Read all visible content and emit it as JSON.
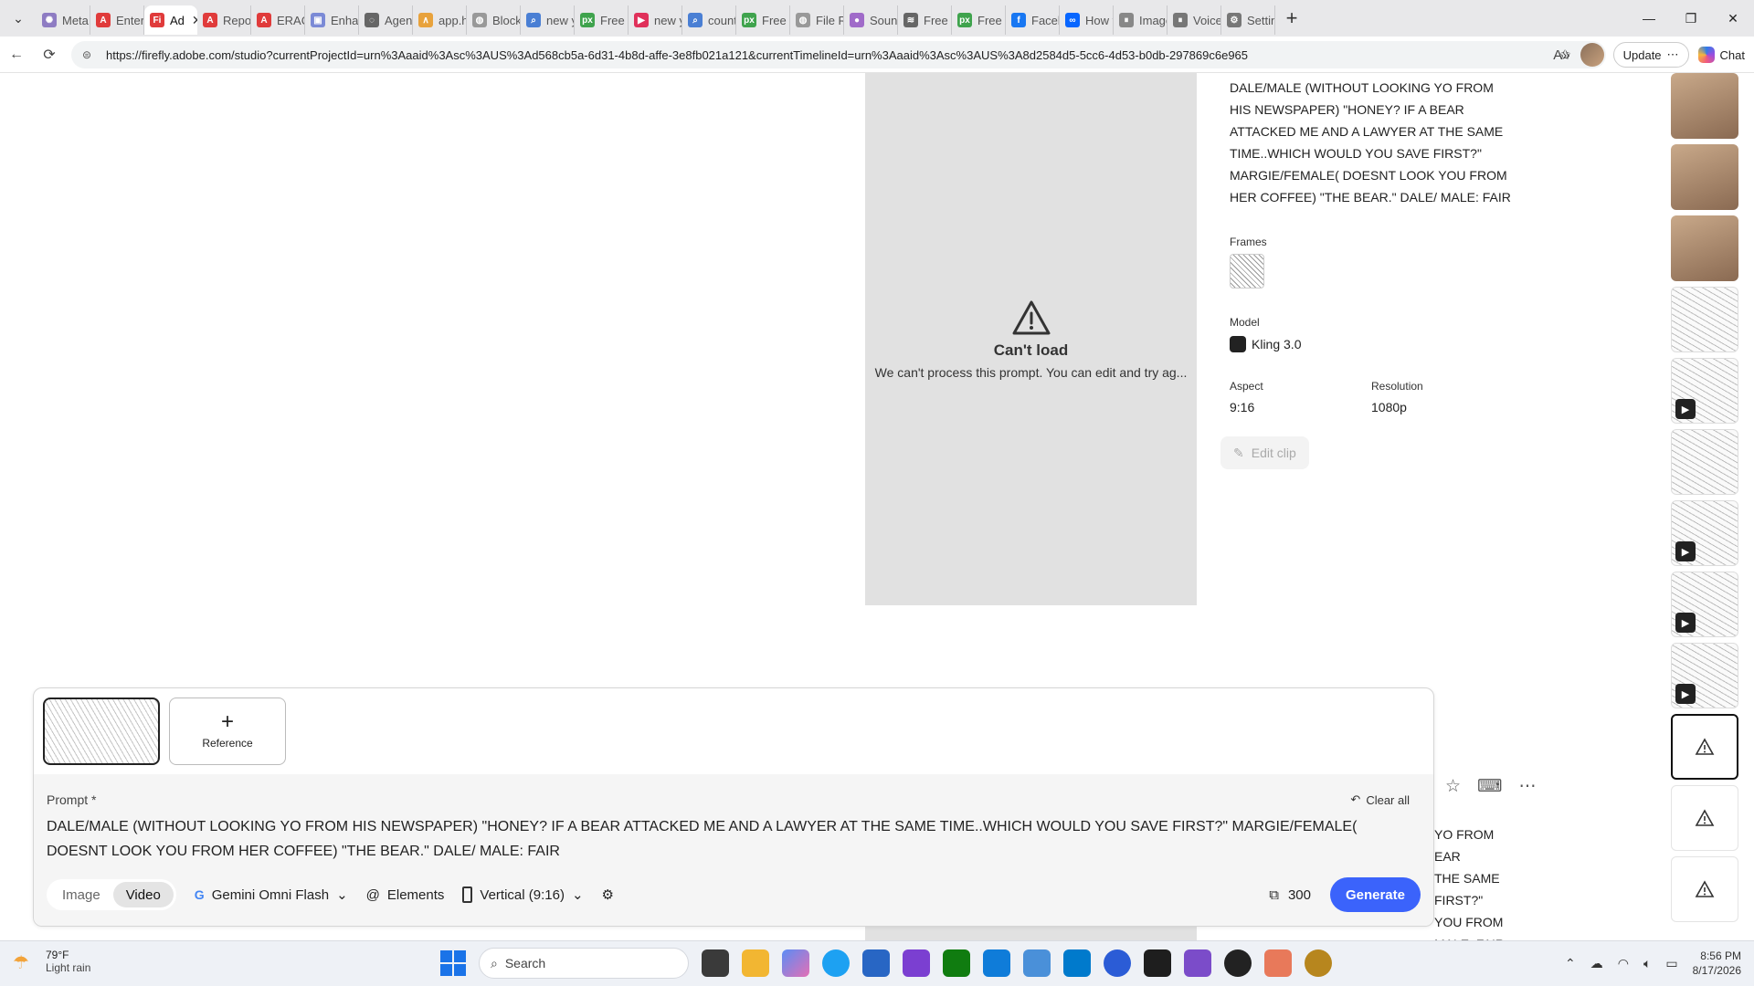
{
  "browser": {
    "tabs": [
      {
        "label": "Meta AI",
        "color": "#8e7cc3",
        "glyph": "✺"
      },
      {
        "label": "Enter y",
        "color": "#e03b3b",
        "glyph": "A"
      },
      {
        "label": "Ad",
        "color": "#e03b3b",
        "glyph": "Fi",
        "active": true
      },
      {
        "label": "Report",
        "color": "#e03b3b",
        "glyph": "A"
      },
      {
        "label": "ERACTI",
        "color": "#e03b3b",
        "glyph": "A"
      },
      {
        "label": "Enhanc",
        "color": "#7b8ad6",
        "glyph": "▣"
      },
      {
        "label": "Agent",
        "color": "#666666",
        "glyph": "◌"
      },
      {
        "label": "app.hy",
        "color": "#e8a23c",
        "glyph": "∧"
      },
      {
        "label": "Block F",
        "color": "#999999",
        "glyph": "◍"
      },
      {
        "label": "new yo",
        "color": "#4a7fd4",
        "glyph": "⌕"
      },
      {
        "label": "Free N",
        "color": "#3fa34d",
        "glyph": "px"
      },
      {
        "label": "new yo",
        "color": "#e0305a",
        "glyph": "▶"
      },
      {
        "label": "countr",
        "color": "#4a7fd4",
        "glyph": "⌕"
      },
      {
        "label": "Free M",
        "color": "#3fa34d",
        "glyph": "px"
      },
      {
        "label": "File Re",
        "color": "#999999",
        "glyph": "◍"
      },
      {
        "label": "Sound",
        "color": "#a06bc9",
        "glyph": "●"
      },
      {
        "label": "Free Ti",
        "color": "#666666",
        "glyph": "≋"
      },
      {
        "label": "Free M",
        "color": "#3fa34d",
        "glyph": "px"
      },
      {
        "label": "Facebo",
        "color": "#1877f2",
        "glyph": "f"
      },
      {
        "label": "How to",
        "color": "#0866ff",
        "glyph": "∞"
      },
      {
        "label": "Image",
        "color": "#888888",
        "glyph": "⏸"
      },
      {
        "label": "Voice D",
        "color": "#777777",
        "glyph": "⏸"
      },
      {
        "label": "Setting",
        "color": "#777777",
        "glyph": "⚙"
      }
    ],
    "url": "https://firefly.adobe.com/studio?currentProjectId=urn%3Aaaid%3Asc%3AUS%3Ad568cb5a-6d31-4b8d-affe-3e8fb021a121&currentTimelineId=urn%3Aaaid%3Asc%3AUS%3A8d2584d5-5cc6-4d53-b0db-297869c6e965",
    "update_label": "Update",
    "chat_label": "Chat"
  },
  "preview": {
    "error_title": "Can't load",
    "error_message": "We can't process this prompt. You can edit and try ag..."
  },
  "details": {
    "prompt": "DALE/MALE (WITHOUT LOOKING YO FROM HIS NEWSPAPER) \"HONEY? IF A BEAR ATTACKED ME AND A LAWYER AT THE SAME TIME..WHICH WOULD YOU SAVE FIRST?\" MARGIE/FEMALE( DOESNT LOOK YOU FROM HER COFFEE) \"THE BEAR.\" DALE/ MALE: FAIR",
    "frames_label": "Frames",
    "model_label": "Model",
    "model_value": "Kling 3.0",
    "aspect_label": "Aspect",
    "aspect_value": "9:16",
    "resolution_label": "Resolution",
    "resolution_value": "1080p",
    "edit_clip_label": "Edit clip"
  },
  "history_peek": {
    "lines": [
      "YO FROM",
      "EAR",
      "THE SAME",
      "FIRST?\"",
      "YOU FROM",
      "MALE: FAIR"
    ]
  },
  "composer": {
    "reference_label": "Reference",
    "prompt_label": "Prompt *",
    "clear_all_label": "Clear all",
    "prompt_text": "DALE/MALE (WITHOUT LOOKING YO FROM HIS NEWSPAPER) \"HONEY? IF A BEAR ATTACKED ME AND A LAWYER AT THE SAME TIME..WHICH WOULD YOU SAVE FIRST?\" MARGIE/FEMALE( DOESNT LOOK YOU FROM HER COFFEE) \"THE BEAR.\" DALE/ MALE: FAIR",
    "mode_image": "Image",
    "mode_video": "Video",
    "model_name": "Gemini Omni Flash",
    "elements_label": "Elements",
    "aspect_label": "Vertical (9:16)",
    "credits": "300",
    "generate_label": "Generate"
  },
  "taskbar": {
    "temperature": "79°F",
    "condition": "Light rain",
    "search_placeholder": "Search",
    "time": "8:56 PM",
    "date": "8/17/2026"
  }
}
